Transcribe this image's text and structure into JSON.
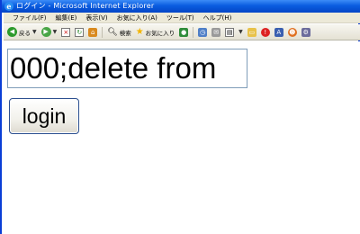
{
  "window": {
    "title": "ログイン - Microsoft Internet Explorer",
    "app_icon": "e"
  },
  "menu": {
    "items": [
      "ファイル(F)",
      "編集(E)",
      "表示(V)",
      "お気に入り(A)",
      "ツール(T)",
      "ヘルプ(H)"
    ]
  },
  "toolbar": {
    "back_label": "戻る",
    "search_label": "検索",
    "favorites_label": "お気に入り"
  },
  "form": {
    "text_value": "000;delete from",
    "login_label": "login"
  },
  "colors": {
    "titlebar": "#0a5ce0",
    "chrome": "#ece9d8",
    "input_border": "#7f9db9"
  }
}
